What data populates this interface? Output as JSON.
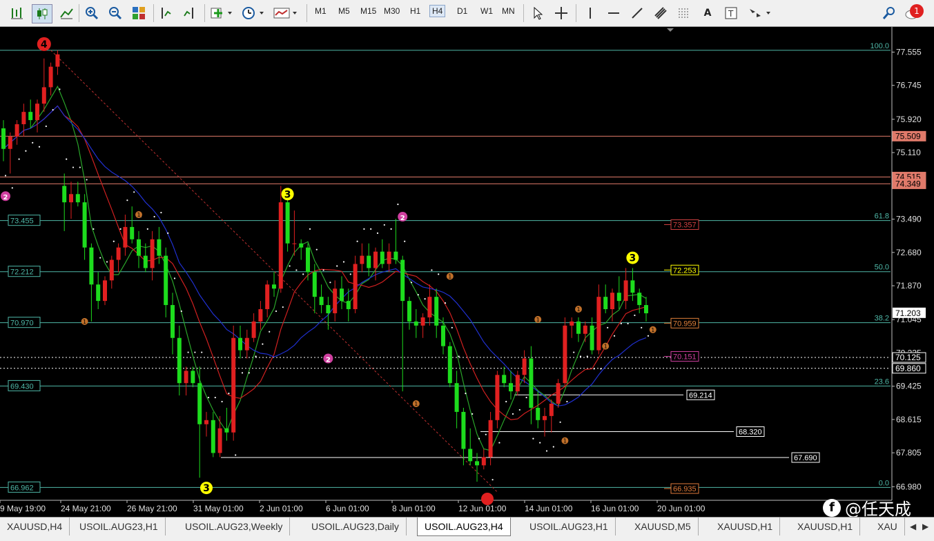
{
  "toolbar": {
    "timeframes": [
      "M1",
      "M5",
      "M15",
      "M30",
      "H1",
      "H4",
      "D1",
      "W1",
      "MN"
    ],
    "active_timeframe": "H4",
    "notification_count": "1",
    "text_tool": "A"
  },
  "tabs": [
    "XAUUSD,H4",
    "USOIL.AUG23,H1",
    "USOIL.AUG23,Weekly",
    "USOIL.AUG23,Daily",
    "USOIL.AUG23,H4",
    "USOIL.AUG23,H1",
    "XAUUSD,M5",
    "XAUUSD,H1",
    "XAUUSD,H1",
    "XAU"
  ],
  "active_tab_index": 4,
  "watermark": "@任天成",
  "chart_data": {
    "type": "candlestick",
    "symbol": "USOIL.AUG23",
    "timeframe": "H4",
    "x_ticks": [
      "9 May 19:00",
      "24 May 21:00",
      "26 May 21:00",
      "31 May 01:00",
      "2 Jun 01:00",
      "6 Jun 01:00",
      "8 Jun 01:00",
      "12 Jun 01:00",
      "14 Jun 01:00",
      "16 Jun 01:00",
      "20 Jun 01:00"
    ],
    "y_ticks": [
      "77.555",
      "76.745",
      "75.920",
      "75.110",
      "74.349",
      "73.490",
      "72.680",
      "71.870",
      "71.045",
      "70.235",
      "69.425",
      "68.615",
      "67.805",
      "66.980"
    ],
    "ylim": [
      66.75,
      78.0
    ],
    "current_price": "71.203",
    "price_tags": [
      {
        "text": "75.509",
        "color": "#e07a6a"
      },
      {
        "text": "74.515",
        "color": "#e07a6a"
      },
      {
        "text": "74.349",
        "color": "#e07a6a"
      },
      {
        "text": "70.125",
        "color": "#ffffff"
      },
      {
        "text": "69.860",
        "color": "#ffffff"
      }
    ],
    "fib_levels": [
      {
        "pct": "100.0",
        "price": 77.6
      },
      {
        "pct": "61.8",
        "price": 73.455
      },
      {
        "pct": "50.0",
        "price": 72.212
      },
      {
        "pct": "38.2",
        "price": 70.97
      },
      {
        "pct": "23.6",
        "price": 69.43
      },
      {
        "pct": "0.0",
        "price": 66.962
      }
    ],
    "fib_left_labels": [
      "73.455",
      "72.212",
      "70.970",
      "69.430",
      "66.962"
    ],
    "red_lines": [
      75.509,
      74.515,
      74.349
    ],
    "dotted_lines": [
      70.125,
      69.86
    ],
    "boxed_levels": [
      {
        "text": "73.357",
        "price": 73.357,
        "color": "#d04040"
      },
      {
        "text": "72.253",
        "price": 72.253,
        "color": "#ffff00"
      },
      {
        "text": "70.959",
        "price": 70.959,
        "color": "#e0803a"
      },
      {
        "text": "70.151",
        "price": 70.151,
        "color": "#d040a0"
      },
      {
        "text": "69.214",
        "price": 69.214,
        "color": "#ffffff"
      },
      {
        "text": "68.320",
        "price": 68.32,
        "color": "#ffffff"
      },
      {
        "text": "67.690",
        "price": 67.69,
        "color": "#ffffff"
      },
      {
        "text": "66.935",
        "price": 66.935,
        "color": "#e07a3a"
      }
    ],
    "wave_labels": [
      {
        "text": "4",
        "price": 77.75,
        "bar": 6,
        "color": "#e02020"
      },
      {
        "text": "3",
        "price": 74.1,
        "bar": 42,
        "color": "#ffff00"
      },
      {
        "text": "3",
        "price": 66.95,
        "bar": 30,
        "color": "#ffff00"
      },
      {
        "text": "3",
        "price": 72.55,
        "bar": 93,
        "color": "#ffff00"
      },
      {
        "text": "2",
        "price": 74.05,
        "bar": 0,
        "color": "#d040a0"
      },
      {
        "text": "2",
        "price": 73.55,
        "bar": 59,
        "color": "#d040a0"
      },
      {
        "text": "2",
        "price": 70.1,
        "bar": 48,
        "color": "#d040a0"
      }
    ],
    "candles": [
      [
        75.7,
        75.9,
        74.9,
        75.2
      ],
      [
        75.2,
        75.6,
        74.6,
        75.5
      ],
      [
        75.5,
        75.9,
        75.3,
        75.8
      ],
      [
        75.8,
        76.3,
        75.5,
        76.1
      ],
      [
        76.1,
        76.4,
        75.7,
        75.9
      ],
      [
        75.9,
        76.4,
        75.6,
        76.3
      ],
      [
        76.3,
        77.4,
        76.1,
        76.7
      ],
      [
        76.7,
        77.3,
        76.5,
        77.2
      ],
      [
        77.2,
        77.6,
        77.0,
        77.5
      ],
      [
        74.3,
        74.6,
        73.2,
        73.9
      ],
      [
        73.9,
        74.4,
        73.5,
        74.1
      ],
      [
        74.1,
        74.4,
        73.8,
        73.9
      ],
      [
        73.9,
        74.1,
        72.5,
        72.8
      ],
      [
        72.8,
        72.9,
        71.0,
        71.9
      ],
      [
        71.9,
        72.2,
        71.3,
        71.5
      ],
      [
        71.5,
        72.1,
        71.4,
        72.0
      ],
      [
        72.0,
        72.6,
        71.8,
        72.5
      ],
      [
        72.5,
        72.9,
        72.2,
        72.8
      ],
      [
        72.8,
        73.6,
        72.6,
        73.3
      ],
      [
        73.3,
        73.8,
        72.9,
        73.0
      ],
      [
        73.0,
        73.2,
        72.3,
        72.6
      ],
      [
        72.6,
        72.9,
        72.2,
        72.3
      ],
      [
        72.3,
        73.2,
        72.0,
        73.0
      ],
      [
        73.0,
        73.3,
        72.4,
        72.6
      ],
      [
        72.6,
        72.8,
        71.1,
        71.4
      ],
      [
        71.4,
        71.7,
        70.2,
        70.6
      ],
      [
        70.6,
        70.9,
        69.2,
        69.5
      ],
      [
        69.5,
        69.9,
        69.2,
        69.8
      ],
      [
        69.8,
        69.9,
        69.4,
        69.5
      ],
      [
        69.5,
        69.9,
        67.2,
        68.5
      ],
      [
        68.5,
        68.8,
        68.2,
        68.6
      ],
      [
        68.6,
        68.8,
        67.7,
        67.8
      ],
      [
        67.8,
        68.7,
        67.7,
        68.4
      ],
      [
        68.4,
        68.9,
        68.1,
        68.3
      ],
      [
        68.3,
        70.9,
        68.1,
        70.6
      ],
      [
        70.6,
        70.9,
        70.1,
        70.3
      ],
      [
        70.3,
        70.8,
        70.1,
        70.6
      ],
      [
        70.6,
        71.2,
        70.5,
        71.0
      ],
      [
        71.0,
        71.5,
        70.8,
        71.3
      ],
      [
        71.3,
        72.0,
        71.1,
        71.9
      ],
      [
        71.9,
        72.2,
        71.6,
        71.8
      ],
      [
        71.8,
        74.3,
        71.7,
        73.9
      ],
      [
        73.9,
        74.0,
        72.7,
        72.9
      ],
      [
        72.9,
        73.7,
        72.6,
        72.9
      ],
      [
        72.9,
        73.0,
        72.5,
        72.8
      ],
      [
        72.8,
        72.9,
        72.0,
        72.2
      ],
      [
        72.2,
        72.4,
        71.2,
        71.6
      ],
      [
        71.6,
        71.9,
        71.2,
        71.4
      ],
      [
        71.4,
        71.6,
        70.8,
        71.2
      ],
      [
        71.2,
        72.0,
        71.0,
        71.8
      ],
      [
        71.8,
        72.1,
        71.3,
        71.5
      ],
      [
        71.5,
        71.8,
        71.0,
        71.3
      ],
      [
        71.3,
        72.6,
        71.2,
        72.4
      ],
      [
        72.4,
        72.9,
        72.2,
        72.6
      ],
      [
        72.6,
        72.9,
        72.1,
        72.3
      ],
      [
        72.3,
        72.8,
        72.0,
        72.7
      ],
      [
        72.7,
        73.0,
        72.3,
        72.4
      ],
      [
        72.4,
        72.9,
        72.2,
        72.7
      ],
      [
        72.7,
        73.5,
        72.4,
        72.5
      ],
      [
        72.5,
        72.6,
        69.3,
        71.5
      ],
      [
        71.5,
        71.6,
        70.8,
        71.0
      ],
      [
        71.0,
        71.3,
        70.6,
        70.9
      ],
      [
        70.9,
        71.2,
        70.6,
        71.1
      ],
      [
        71.1,
        71.9,
        70.9,
        71.6
      ],
      [
        71.6,
        71.8,
        70.6,
        70.9
      ],
      [
        70.9,
        71.1,
        70.2,
        70.4
      ],
      [
        70.4,
        70.5,
        69.4,
        69.5
      ],
      [
        69.5,
        69.8,
        68.4,
        68.8
      ],
      [
        68.8,
        68.9,
        67.5,
        67.9
      ],
      [
        67.9,
        68.4,
        67.5,
        67.6
      ],
      [
        67.6,
        67.8,
        67.1,
        67.5
      ],
      [
        67.5,
        67.9,
        67.4,
        67.7
      ],
      [
        67.7,
        68.8,
        67.5,
        68.6
      ],
      [
        68.6,
        69.8,
        68.4,
        69.7
      ],
      [
        69.7,
        69.9,
        69.4,
        69.5
      ],
      [
        69.5,
        69.8,
        69.1,
        69.3
      ],
      [
        69.3,
        69.8,
        69.2,
        69.7
      ],
      [
        69.7,
        70.3,
        69.5,
        70.1
      ],
      [
        70.1,
        70.4,
        68.5,
        68.9
      ],
      [
        68.9,
        69.3,
        68.4,
        68.6
      ],
      [
        68.6,
        68.9,
        68.2,
        68.7
      ],
      [
        68.7,
        69.1,
        68.3,
        69.0
      ],
      [
        69.0,
        69.6,
        68.9,
        69.5
      ],
      [
        69.5,
        71.1,
        69.4,
        70.9
      ],
      [
        70.9,
        71.1,
        70.6,
        71.0
      ],
      [
        71.0,
        71.1,
        70.5,
        70.7
      ],
      [
        70.7,
        71.0,
        70.5,
        70.9
      ],
      [
        70.9,
        71.1,
        70.2,
        70.3
      ],
      [
        70.3,
        71.9,
        70.2,
        71.6
      ],
      [
        71.6,
        71.9,
        71.2,
        71.3
      ],
      [
        71.3,
        71.8,
        71.0,
        71.7
      ],
      [
        71.7,
        72.1,
        71.3,
        71.5
      ],
      [
        71.5,
        72.3,
        71.3,
        72.0
      ],
      [
        72.0,
        72.3,
        71.5,
        71.7
      ],
      [
        71.7,
        71.8,
        71.2,
        71.4
      ],
      [
        71.4,
        71.6,
        71.0,
        71.2
      ]
    ]
  }
}
